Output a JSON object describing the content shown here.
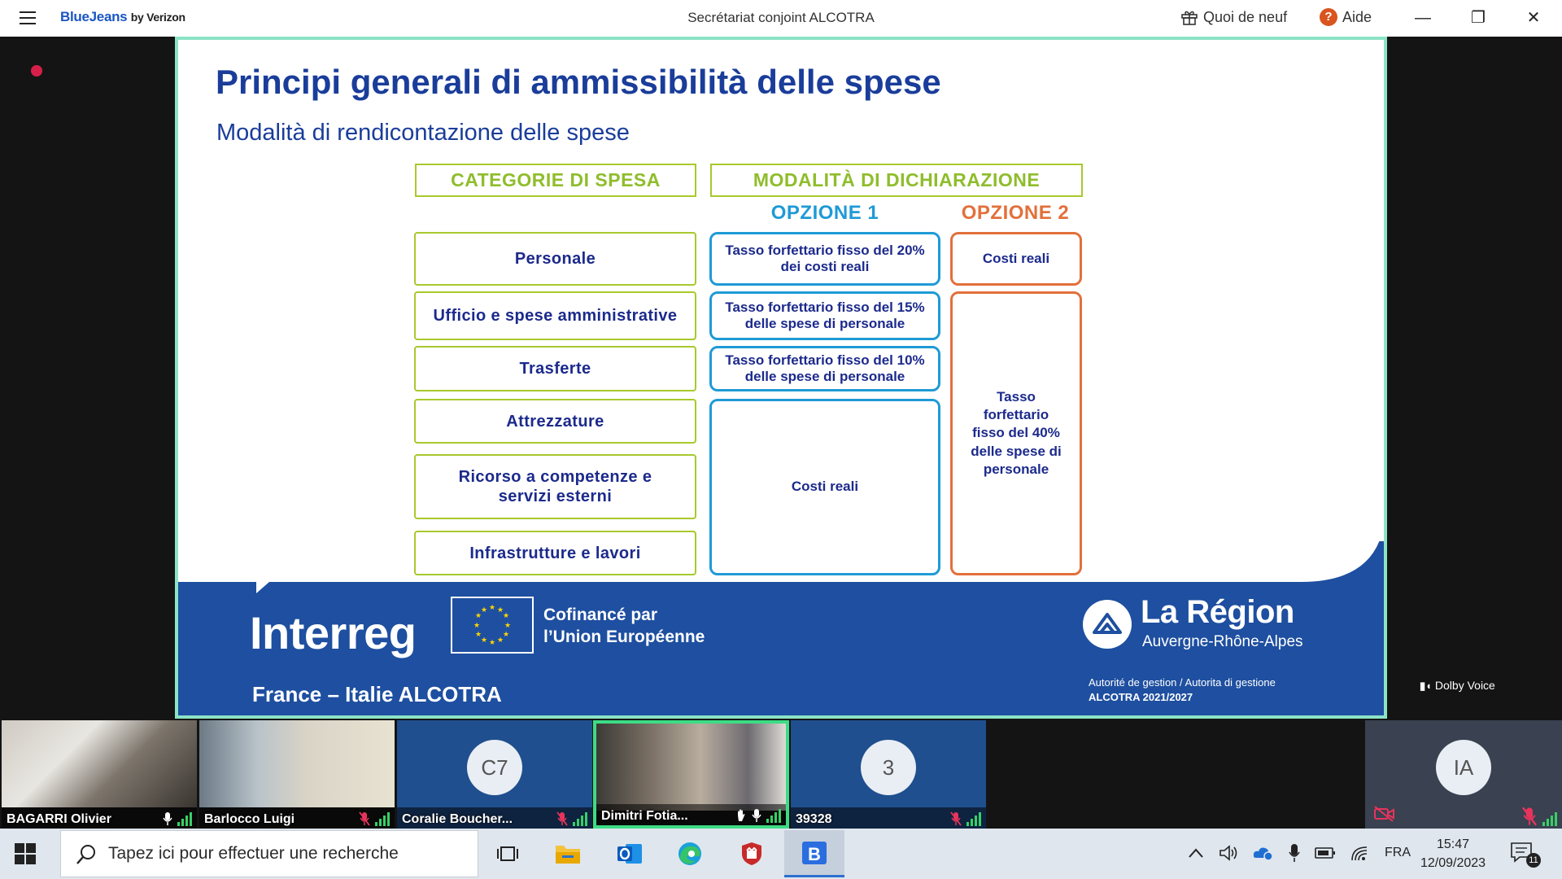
{
  "app": {
    "brand": "BlueJeans",
    "brand_by": "by Verizon",
    "meeting_title": "Secrétariat conjoint ALCOTRA",
    "whats_new": "Quoi de neuf",
    "help": "Aide",
    "help_glyph": "?",
    "window_controls": [
      "—",
      "❐",
      "✕"
    ]
  },
  "slide": {
    "title": "Principi generali di ammissibilità delle spese",
    "subtitle": "Modalità di rendicontazione delle spese",
    "header_categories": "CATEGORIE DI SPESA",
    "header_modalities": "MODALITÀ DI DICHIARAZIONE",
    "option1": "OPZIONE 1",
    "option2": "OPZIONE 2",
    "categories": [
      "Personale",
      "Ufficio e spese amministrative",
      "Trasferte",
      "Attrezzature",
      "Ricorso a competenze e servizi esterni",
      "Infrastrutture e lavori"
    ],
    "option1_boxes": [
      "Tasso forfettario fisso del 20% dei costi reali",
      "Tasso forfettario fisso del 15% delle spese di personale",
      "Tasso forfettario fisso del 10% delle spese di personale",
      "Costi reali"
    ],
    "option2_boxes": [
      "Costi reali",
      "Tasso forfettario fisso del 40% delle spese di personale"
    ],
    "footer": {
      "interreg": "Interreg",
      "cofinance_line1": "Cofinancé par",
      "cofinance_line2": "l’Union Européenne",
      "region_name": "La Région",
      "region_sub": "Auvergne-Rhône-Alpes",
      "program": "France – Italie ALCOTRA",
      "authority_line1": "Autorité de gestion / Autorita di gestione",
      "authority_line2": "ALCOTRA 2021/2027"
    },
    "dolby": "Dolby Voice"
  },
  "participants": [
    {
      "name": "BAGARRI Olivier",
      "type": "video",
      "muted": false
    },
    {
      "name": "Barlocco Luigi",
      "type": "video",
      "muted": true
    },
    {
      "name": "Coralie Boucher...",
      "type": "avatar",
      "initials": "C7",
      "muted": true
    },
    {
      "name": "Dimitri Fotia...",
      "type": "video",
      "muted": false,
      "active": true,
      "hand_raised": true
    },
    {
      "name": "39328",
      "type": "avatar",
      "initials": "3",
      "muted": true
    },
    {
      "name": "",
      "type": "self",
      "initials": "IA",
      "muted": true,
      "camera_off": true
    }
  ],
  "taskbar": {
    "search_placeholder": "Tapez ici pour effectuer une recherche",
    "language": "FRA",
    "time": "15:47",
    "date": "12/09/2023",
    "notifications": "11"
  },
  "colors": {
    "brand_blue": "#1a56c4",
    "slide_title": "#1a3d9a",
    "green_border": "#a8c92d",
    "option_blue": "#1f9ad6",
    "option_orange": "#e2703b",
    "band_blue": "#1e4fa0",
    "active_tile": "#3ddc84",
    "recording": "#d6204a"
  }
}
